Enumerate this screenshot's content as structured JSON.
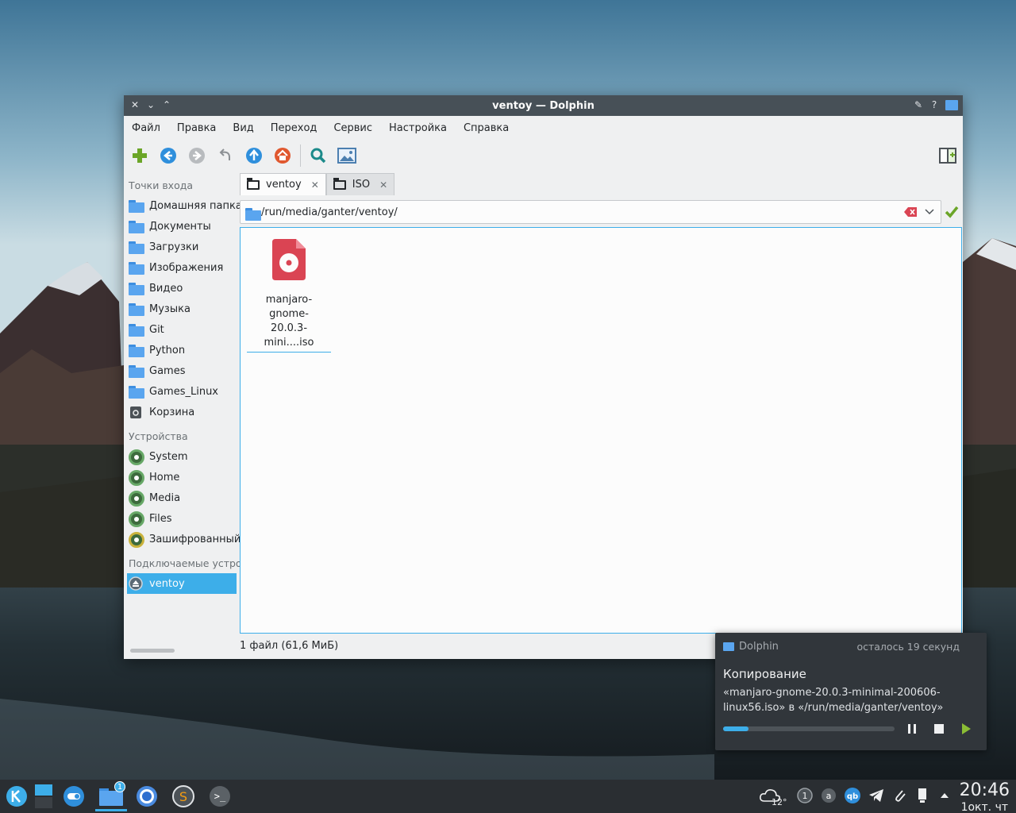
{
  "window": {
    "title": "ventoy — Dolphin",
    "menu": [
      "Файл",
      "Правка",
      "Вид",
      "Переход",
      "Сервис",
      "Настройка",
      "Справка"
    ]
  },
  "sidebar": {
    "places_header": "Точки входа",
    "places": [
      "Домашняя папка",
      "Документы",
      "Загрузки",
      "Изображения",
      "Видео",
      "Музыка",
      "Git",
      "Python",
      "Games",
      "Games_Linux",
      "Корзина"
    ],
    "devices_header": "Устройства",
    "devices": [
      "System",
      "Home",
      "Media",
      "Files",
      "Зашифрованный"
    ],
    "removable_header": "Подключаемые устро",
    "removable": [
      "ventoy"
    ]
  },
  "tabs": [
    "ventoy",
    "ISO"
  ],
  "address": {
    "path": "/run/media/ganter/ventoy/"
  },
  "files": [
    {
      "name_line1": "manjaro-gnome-",
      "name_line2": "20.0.3-mini....iso"
    }
  ],
  "status": {
    "text": "1 файл (61,6 МиБ)"
  },
  "notification": {
    "app": "Dolphin",
    "time_left": "осталось 19 секунд",
    "title": "Копирование",
    "body": "«manjaro-gnome-20.0.3-minimal-200606-linux56.iso» в «/run/media/ganter/ventoy»",
    "progress": 0.15
  },
  "taskbar": {
    "weather_temp": "12°",
    "badge_count": "1",
    "tray_badge": "1",
    "time": "20:46",
    "date": "1окт. чт"
  },
  "colors": {
    "accent": "#3daee9",
    "titlebar": "#475057",
    "panel": "#2a2e32"
  }
}
